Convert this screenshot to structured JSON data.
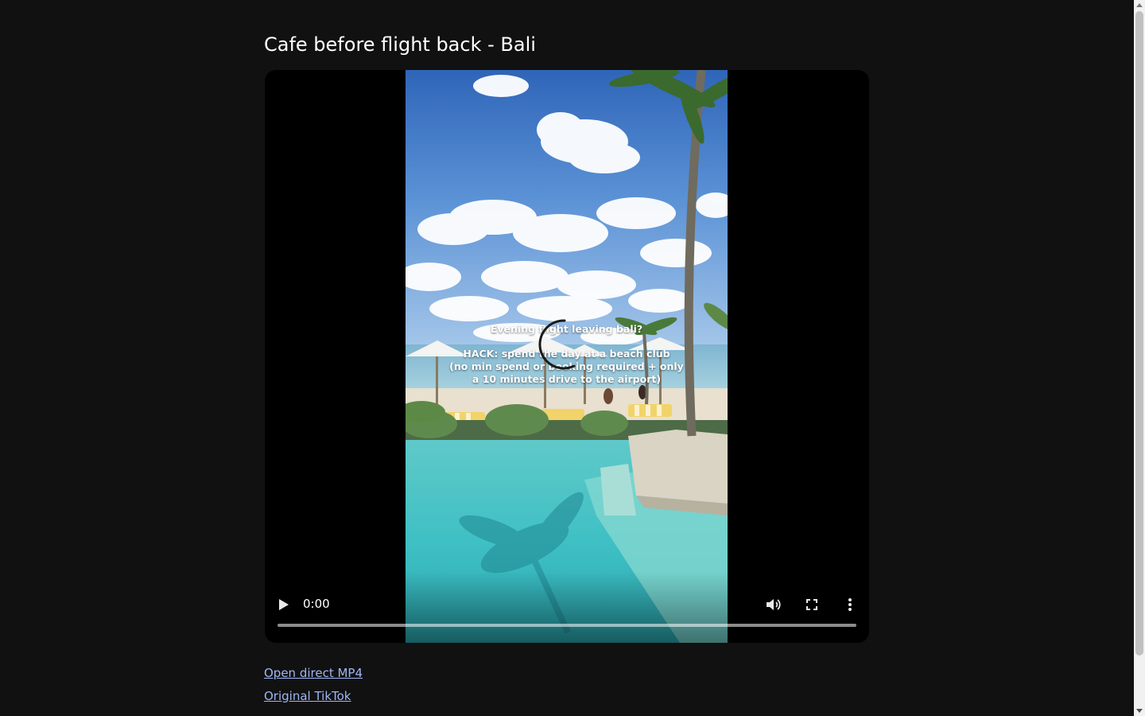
{
  "page": {
    "title": "Cafe before flight back - Bali"
  },
  "video": {
    "caption_lines": [
      "Evening flight leaving bali?",
      "HACK: spend the day at a beach club",
      "(no min spend or booking required + only",
      "a 10 minutes drive to the airport)"
    ],
    "current_time": "0:00",
    "progress": 0,
    "controls": {
      "play_icon": "play-icon",
      "volume_icon": "volume-icon",
      "fullscreen_icon": "fullscreen-icon",
      "more_icon": "more-options-icon",
      "loading_icon": "loading-spinner-icon"
    }
  },
  "links": {
    "direct_mp4": "Open direct MP4",
    "original_tiktok": "Original TikTok"
  },
  "colors": {
    "background": "#111111",
    "link": "#9db7f5",
    "player_bg": "#000000"
  }
}
